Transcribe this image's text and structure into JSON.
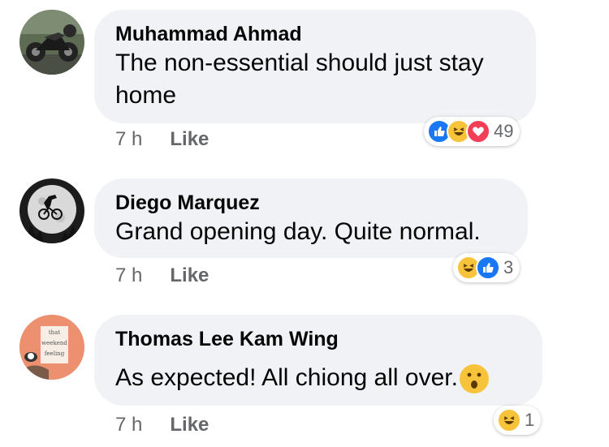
{
  "comments": [
    {
      "author": "Muhammad Ahmad",
      "text_line1": "The non-essential should just stay",
      "text_line2": "home",
      "time": "7 h",
      "like_label": "Like",
      "reaction_count": "49",
      "reactions": [
        "like-icon",
        "haha-icon",
        "love-icon"
      ],
      "avatar": "motorcycle-avatar"
    },
    {
      "author": "Diego Marquez",
      "text": "Grand opening day. Quite normal.",
      "time": "7 h",
      "like_label": "Like",
      "reaction_count": "3",
      "reactions": [
        "haha-icon",
        "like-icon"
      ],
      "avatar": "dinosaur-bike-moon-avatar"
    },
    {
      "author": "Thomas Lee Kam Wing",
      "text": "As expected! All chiong all over.",
      "time": "7 h",
      "like_label": "Like",
      "reaction_count": "1",
      "reactions": [
        "haha-icon"
      ],
      "avatar": "that-weekend-feeling-avatar",
      "avatar_text": [
        "that",
        "weekend",
        "feeling"
      ],
      "emoji": "wow-emoji"
    }
  ],
  "colors": {
    "bubble": "#f0f2f5",
    "meta": "#65676b",
    "like_blue": "#1877f2",
    "haha_yellow": "#f7c33a",
    "love_red": "#f33e58"
  }
}
